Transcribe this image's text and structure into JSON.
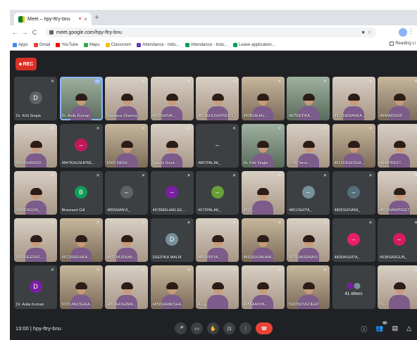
{
  "browser": {
    "tab_title": "Meet – hpy-ftry-bnu",
    "tab_close": "×",
    "new_tab": "+",
    "url": "meet.google.com/hpy-ftry-bnu",
    "back": "←",
    "forward": "→",
    "reload": "C",
    "bookmarks": [
      {
        "label": "Apps",
        "color": "#4285f4"
      },
      {
        "label": "Gmail",
        "color": "#ea4335"
      },
      {
        "label": "YouTube",
        "color": "#ff0000"
      },
      {
        "label": "Maps",
        "color": "#34a853"
      },
      {
        "label": "Classroom",
        "color": "#fbbc04"
      },
      {
        "label": "Attendance - Indu...",
        "color": "#673ab7"
      },
      {
        "label": "Attendance - Indu...",
        "color": "#0f9d58"
      },
      {
        "label": "Leave application...",
        "color": "#0f9d58"
      }
    ],
    "reading_list": "Reading Li"
  },
  "rec_label": "REC",
  "tiles": [
    {
      "name": "Dr. Kirti Singla",
      "kind": "avatar",
      "letter": "D",
      "color": "#5f6368"
    },
    {
      "name": "Dr. Anila Kumari",
      "kind": "video",
      "variant": "v4",
      "active": true,
      "more": true
    },
    {
      "name": "Vandana Sharma",
      "kind": "video",
      "variant": "v2"
    },
    {
      "name": "4809SHIVA...",
      "kind": "video",
      "variant": "v2"
    },
    {
      "name": "4819KHUSHPREET...",
      "kind": "video",
      "variant": "v2"
    },
    {
      "name": "4808SAHAJ...",
      "kind": "video",
      "variant": "v3"
    },
    {
      "name": "4875NITIKA...",
      "kind": "video",
      "variant": "v4"
    },
    {
      "name": "4917HEMANKA...",
      "kind": "video",
      "variant": "v2"
    },
    {
      "name": "4840ARSHIP...",
      "kind": "video",
      "variant": "v3"
    },
    {
      "name": "5069SHRADD...",
      "kind": "video",
      "variant": "v2"
    },
    {
      "name": "4847KHUSHPRE...",
      "kind": "avatar",
      "letter": "–",
      "color": "#c2185b"
    },
    {
      "name": "5069 NIDHI",
      "kind": "video",
      "variant": "v3"
    },
    {
      "name": "Sakshi Sood...",
      "kind": "video",
      "variant": "v2"
    },
    {
      "name": "4867PALAK_",
      "kind": "avatar",
      "letter": "–",
      "color": "#3c4043"
    },
    {
      "name": "Dr. Kirti Singla",
      "kind": "video",
      "variant": "v4"
    },
    {
      "name": "1149 Tanvi...",
      "kind": "video",
      "variant": "v2"
    },
    {
      "name": "4812DEEKSHA...",
      "kind": "video",
      "variant": "v3"
    },
    {
      "name": "4840PREET...",
      "kind": "video",
      "variant": "v2"
    },
    {
      "name": "4858FAGUN_",
      "kind": "video",
      "variant": "v2"
    },
    {
      "name": "Bhavneet Gill",
      "kind": "avatar",
      "letter": "B",
      "color": "#0f9d58"
    },
    {
      "name": "4855MANVI_",
      "kind": "avatar",
      "letter": "–",
      "color": "#5f6368"
    },
    {
      "name": "4978MEHAKLEE...",
      "kind": "avatar",
      "letter": "–",
      "color": "#7b1fa2"
    },
    {
      "name": "4972PALAK_",
      "kind": "avatar",
      "letter": "–",
      "color": "#689f38"
    },
    {
      "name": "4821...",
      "kind": "video",
      "variant": "v2"
    },
    {
      "name": "4851ISHITA_",
      "kind": "avatar",
      "letter": "–",
      "color": "#78909c"
    },
    {
      "name": "4805SHIVANI_",
      "kind": "avatar",
      "letter": "–",
      "color": "#546e7a"
    },
    {
      "name": "4816MANPREET_",
      "kind": "video",
      "variant": "v2"
    },
    {
      "name": "4928SEERAT...",
      "kind": "video",
      "variant": "v2"
    },
    {
      "name": "4813RADHIKA...",
      "kind": "video",
      "variant": "v3"
    },
    {
      "name": "4821MUSKAN...",
      "kind": "video",
      "variant": "v2"
    },
    {
      "name": "DEEPIKA MALIK",
      "kind": "avatar",
      "letter": "D",
      "color": "#78909c"
    },
    {
      "name": "4850PRIYA...",
      "kind": "video",
      "variant": "v2"
    },
    {
      "name": "4863SHUBHAM...",
      "kind": "video",
      "variant": "v3"
    },
    {
      "name": "4978VAISHNAVI...",
      "kind": "video",
      "variant": "v2"
    },
    {
      "name": "4806AISHITA_",
      "kind": "avatar",
      "letter": "–",
      "color": "#e91e63"
    },
    {
      "name": "4938SARGUN_",
      "kind": "avatar",
      "letter": "–",
      "color": "#d81b60"
    },
    {
      "name": "Dr. Anila Kumari",
      "kind": "avatar",
      "letter": "D",
      "color": "#7b1fa2"
    },
    {
      "name": "5033 ANUSHKA...",
      "kind": "video",
      "variant": "v3"
    },
    {
      "name": "4852AASHIMA...",
      "kind": "video",
      "variant": "v2"
    },
    {
      "name": "4859SAMIKSHA...",
      "kind": "video",
      "variant": "v3"
    },
    {
      "name": "Anuj...",
      "kind": "video",
      "variant": "v2"
    },
    {
      "name": "4956AANYA...",
      "kind": "video",
      "variant": "v2"
    },
    {
      "name": "5082NOVEDEEP",
      "kind": "video",
      "variant": "v3"
    },
    {
      "name": "41 others",
      "kind": "others"
    },
    {
      "name": "You",
      "kind": "video",
      "variant": "v2"
    }
  ],
  "others_colors": [
    "#7b1fa2",
    "#78909c"
  ],
  "bottom": {
    "time": "13:00",
    "separator": "|",
    "meeting_code": "hpy-ftry-bnu",
    "mic_glyph": "🎤",
    "cam_glyph": "▭",
    "hand_glyph": "✋",
    "present_glyph": "⊡",
    "more_glyph": "⋮",
    "end_glyph": "☎",
    "info_glyph": "ⓘ",
    "people_glyph": "👥",
    "people_count": "50",
    "chat_glyph": "▤",
    "activities_glyph": "△"
  }
}
